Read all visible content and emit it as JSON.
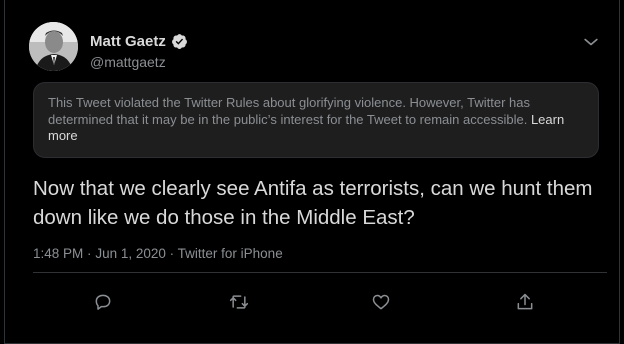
{
  "author": {
    "name": "Matt Gaetz",
    "handle": "@mattgaetz",
    "verified": true
  },
  "notice": {
    "text": "This Tweet violated the Twitter Rules about glorifying violence. However, Twitter has determined that it may be in the public’s interest for the Tweet to remain accessible.",
    "link": "Learn more"
  },
  "tweet": {
    "text": "Now that we clearly see Antifa as terrorists, can we hunt them down like we do those in the Middle East?",
    "time": "1:48 PM",
    "sep1": "·",
    "date": "Jun 1, 2020",
    "sep2": "·",
    "source": "Twitter for iPhone"
  },
  "icons": {
    "verified": "verified-badge-icon",
    "menu": "chevron-down-icon",
    "reply": "reply-icon",
    "retweet": "retweet-icon",
    "like": "heart-icon",
    "share": "share-icon"
  },
  "colors": {
    "background": "#000000",
    "text": "#d9d9d9",
    "muted": "#8b8f93",
    "notice_bg": "#1e1e1f",
    "border": "#2f3336"
  }
}
